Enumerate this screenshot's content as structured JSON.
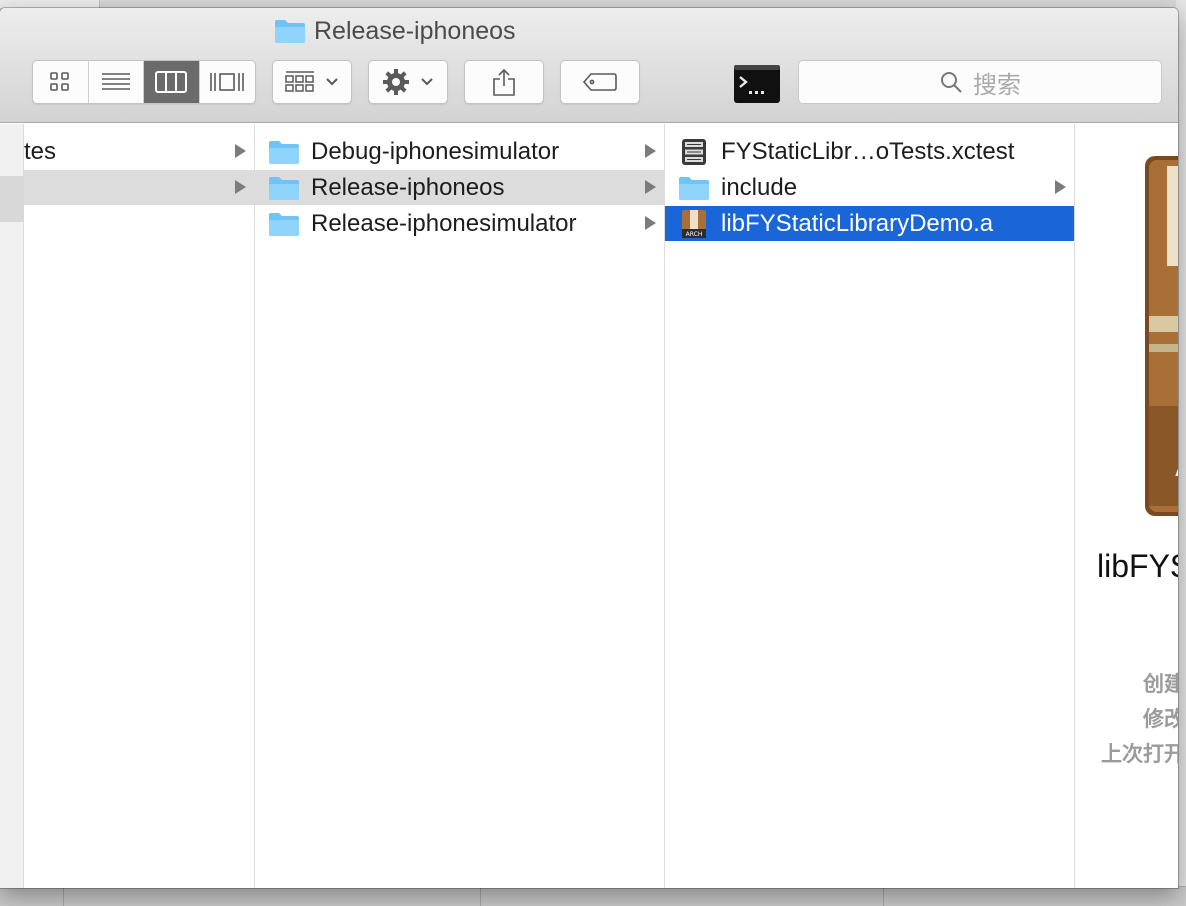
{
  "window": {
    "title": "Release-iphoneos"
  },
  "toolbar": {
    "view_modes": [
      "icon-view",
      "list-view",
      "column-view",
      "coverflow-view"
    ],
    "active_view": "column-view",
    "search_placeholder": "搜索"
  },
  "columns": {
    "col0": [
      {
        "label": "tes",
        "has_children": true,
        "selected": false
      },
      {
        "label": "",
        "has_children": true,
        "selected": true
      }
    ],
    "col1": [
      {
        "label": "Debug-iphonesimulator",
        "has_children": true,
        "selected": false
      },
      {
        "label": "Release-iphoneos",
        "has_children": true,
        "selected": true
      },
      {
        "label": "Release-iphonesimulator",
        "has_children": true,
        "selected": false
      }
    ],
    "col2": [
      {
        "label": "FYStaticLibr…oTests.xctest",
        "type": "xctest",
        "has_children": false,
        "selected": false
      },
      {
        "label": "include",
        "type": "folder",
        "has_children": true,
        "selected": false
      },
      {
        "label": "libFYStaticLibraryDemo.a",
        "type": "archive",
        "has_children": false,
        "selected": true
      }
    ]
  },
  "preview": {
    "name": "libFYS",
    "meta_labels": [
      "创建",
      "修改",
      "上次打开"
    ]
  },
  "colors": {
    "selection_blue": "#1a65d8",
    "folder_blue": "#6fc4f7"
  }
}
